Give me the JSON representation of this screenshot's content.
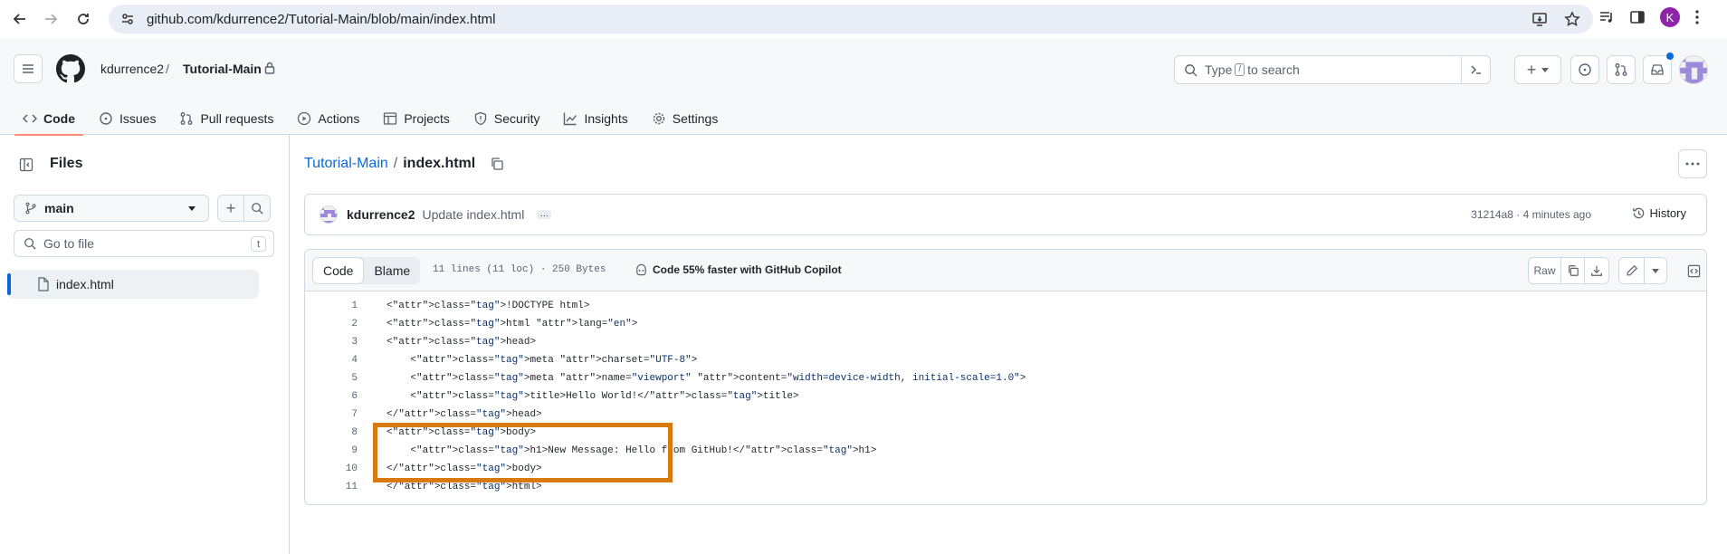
{
  "browser": {
    "url": "github.com/kdurrence2/Tutorial-Main/blob/main/index.html",
    "profile_initial": "K"
  },
  "header": {
    "owner": "kdurrence2",
    "slash": "/",
    "repo": "Tutorial-Main",
    "search_prefix": "Type",
    "search_key": "/",
    "search_suffix": "to search"
  },
  "tabs": [
    {
      "label": "Code",
      "icon": "code-icon"
    },
    {
      "label": "Issues",
      "icon": "issue-icon"
    },
    {
      "label": "Pull requests",
      "icon": "pull-request-icon"
    },
    {
      "label": "Actions",
      "icon": "play-icon"
    },
    {
      "label": "Projects",
      "icon": "table-icon"
    },
    {
      "label": "Security",
      "icon": "shield-icon"
    },
    {
      "label": "Insights",
      "icon": "graph-icon"
    },
    {
      "label": "Settings",
      "icon": "gear-icon"
    }
  ],
  "sidebar": {
    "title": "Files",
    "branch": "main",
    "goto_placeholder": "Go to file",
    "goto_key": "t",
    "files": [
      "index.html"
    ]
  },
  "breadcrumb": {
    "repo": "Tutorial-Main",
    "sep": "/",
    "file": "index.html"
  },
  "commit": {
    "author": "kdurrence2",
    "message": "Update index.html",
    "meta": "31214a8 · 4 minutes ago",
    "history_label": "History"
  },
  "code_toolbar": {
    "code_label": "Code",
    "blame_label": "Blame",
    "file_meta": "11 lines (11 loc) · 250 Bytes",
    "copilot": "Code 55% faster with GitHub Copilot",
    "raw_label": "Raw"
  },
  "code_lines": [
    {
      "n": "1",
      "text": "<!DOCTYPE html>"
    },
    {
      "n": "2",
      "text": "<html lang=\"en\">"
    },
    {
      "n": "3",
      "text": "<head>"
    },
    {
      "n": "4",
      "text": "    <meta charset=\"UTF-8\">"
    },
    {
      "n": "5",
      "text": "    <meta name=\"viewport\" content=\"width=device-width, initial-scale=1.0\">"
    },
    {
      "n": "6",
      "text": "    <title>Hello World!</title>"
    },
    {
      "n": "7",
      "text": "</head>"
    },
    {
      "n": "8",
      "text": "<body>"
    },
    {
      "n": "9",
      "text": "    <h1>New Message: Hello from GitHub!</h1>"
    },
    {
      "n": "10",
      "text": "</body>"
    },
    {
      "n": "11",
      "text": "</html>"
    }
  ],
  "highlight_color": "#d97a10"
}
